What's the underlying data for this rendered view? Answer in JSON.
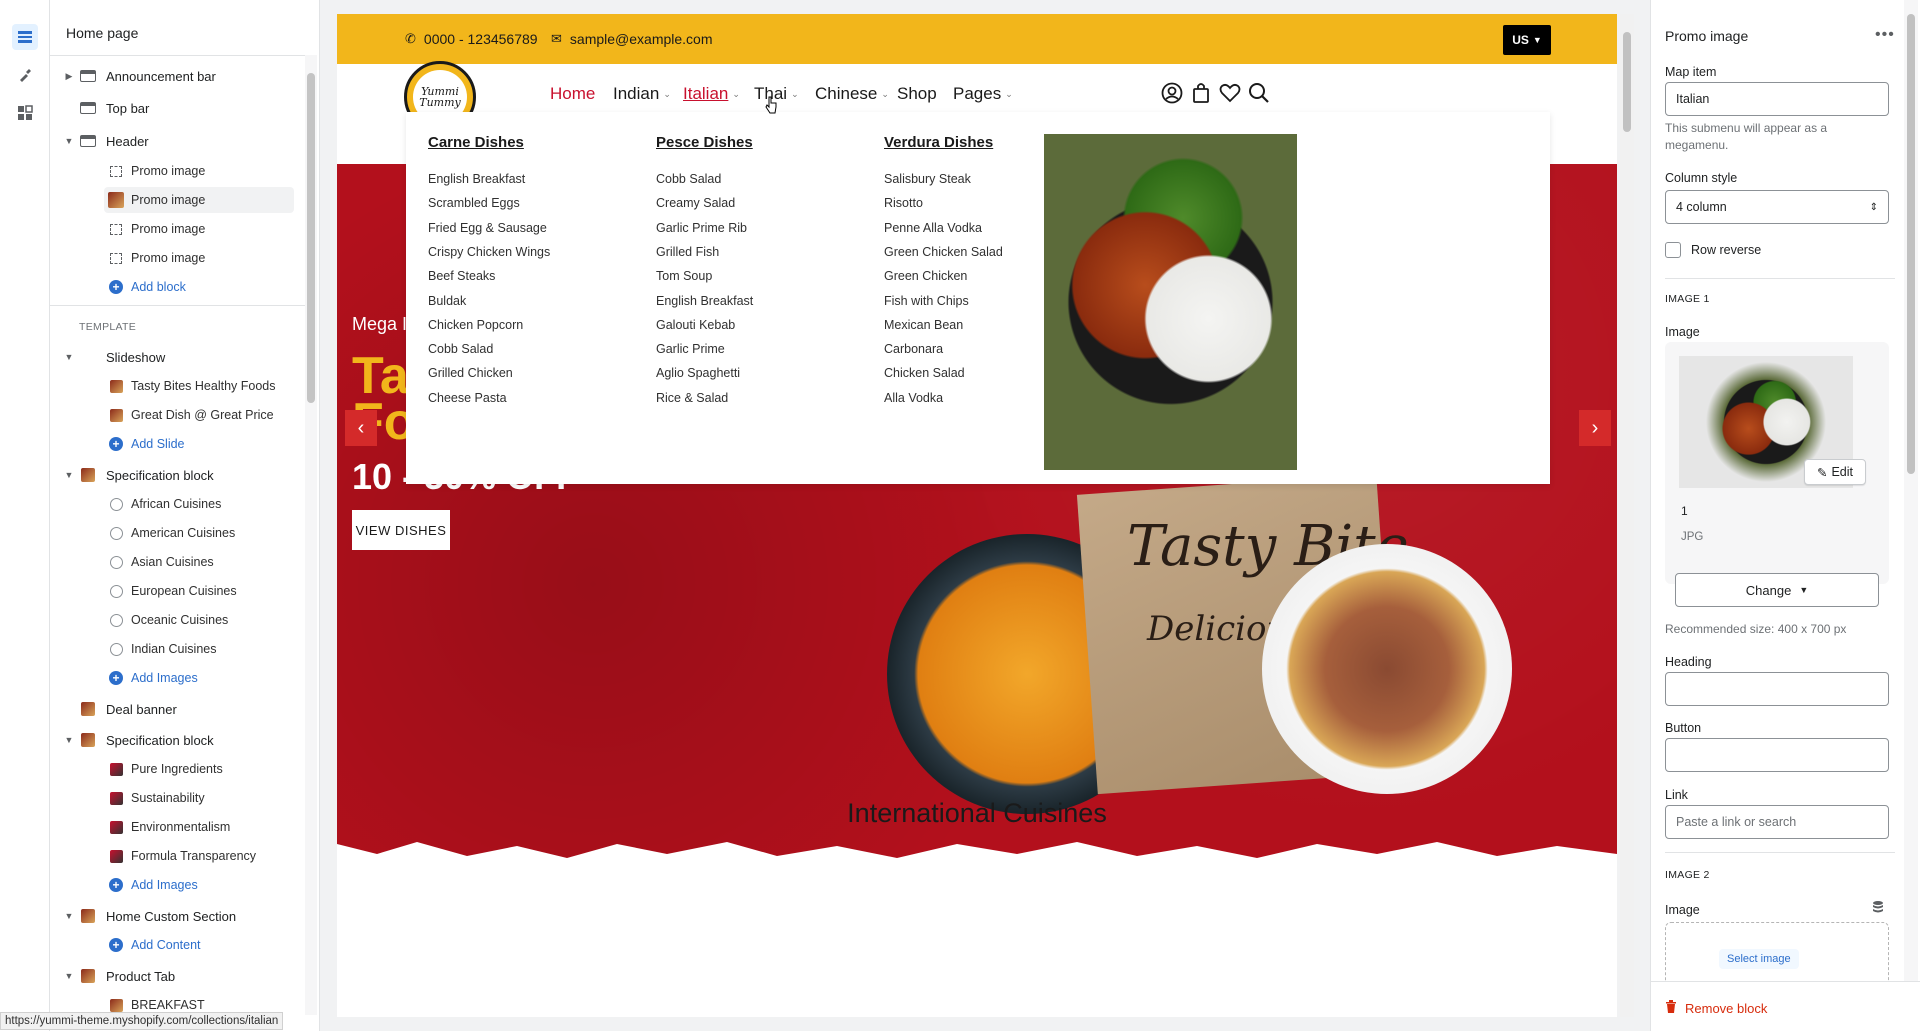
{
  "left_panel": {
    "title": "Home page",
    "tree": [
      {
        "label": "Announcement bar",
        "caret": "▶",
        "icon": "bar"
      },
      {
        "label": "Top bar",
        "caret": "",
        "icon": "bar"
      },
      {
        "label": "Header",
        "caret": "▼",
        "icon": "bar"
      },
      {
        "label": "Promo image",
        "icon": "dash"
      },
      {
        "label": "Promo image",
        "icon": "thumb"
      },
      {
        "label": "Promo image",
        "icon": "dash"
      },
      {
        "label": "Promo image",
        "icon": "dash"
      },
      {
        "label": "Add block",
        "icon": "plus"
      }
    ],
    "template_label": "TEMPLATE",
    "template_tree": [
      {
        "label": "Slideshow",
        "caret": "▼"
      },
      {
        "label": "Tasty Bites Healthy Foods"
      },
      {
        "label": "Great Dish @ Great Price"
      },
      {
        "label": "Add Slide"
      },
      {
        "label": "Specification block",
        "caret": "▼"
      },
      {
        "label": "African Cuisines"
      },
      {
        "label": "American Cuisines"
      },
      {
        "label": "Asian Cuisines"
      },
      {
        "label": "European Cuisines"
      },
      {
        "label": "Oceanic Cuisines"
      },
      {
        "label": "Indian Cuisines"
      },
      {
        "label": "Add Images"
      },
      {
        "label": "Deal banner"
      },
      {
        "label": "Specification block",
        "caret": "▼"
      },
      {
        "label": "Pure Ingredients"
      },
      {
        "label": "Sustainability"
      },
      {
        "label": "Environmentalism"
      },
      {
        "label": "Formula Transparency"
      },
      {
        "label": "Add Images"
      },
      {
        "label": "Home Custom Section",
        "caret": "▼"
      },
      {
        "label": "Add Content"
      },
      {
        "label": "Product Tab",
        "caret": "▼"
      },
      {
        "label": "BREAKFAST"
      }
    ]
  },
  "status_url": "https://yummi-theme.myshopify.com/collections/italian",
  "store": {
    "phone": "0000 - 123456789",
    "email": "sample@example.com",
    "currency": "US",
    "logo_line1": "Yummi",
    "logo_line2": "Tummy",
    "nav": [
      {
        "label": "Home",
        "active": true,
        "chevron": ""
      },
      {
        "label": "Indian",
        "chevron": "⌄"
      },
      {
        "label": "Italian",
        "hover": true,
        "chevron": "⌄"
      },
      {
        "label": "Thai",
        "chevron": "⌄"
      },
      {
        "label": "Chinese",
        "chevron": "⌄"
      },
      {
        "label": "Shop",
        "chevron": ""
      },
      {
        "label": "Pages",
        "chevron": "⌄"
      }
    ],
    "hero": {
      "subtitle": "Mega I",
      "heading_line1": "Ta",
      "heading_line2": "Foods",
      "offer": "10 - 50% OFF",
      "button": "VIEW DISHES",
      "bag_title": "Tasty Bite",
      "bag_subtitle": "Delicious Food",
      "prev": "‹",
      "next": "›"
    },
    "section_title": "International Cuisines"
  },
  "megamenu": {
    "columns": [
      {
        "heading": "Carne Dishes",
        "items": [
          "English Breakfast",
          "Scrambled Eggs",
          "Fried Egg & Sausage",
          "Crispy Chicken Wings",
          "Beef Steaks",
          "Buldak",
          "Chicken Popcorn",
          "Cobb Salad",
          "Grilled Chicken",
          "Cheese Pasta"
        ]
      },
      {
        "heading": "Pesce Dishes",
        "items": [
          "Cobb Salad",
          "Creamy Salad",
          "Garlic Prime Rib",
          "Grilled Fish",
          "Tom Soup",
          "English Breakfast",
          "Galouti Kebab",
          "Garlic Prime",
          "Aglio Spaghetti",
          "Rice & Salad"
        ]
      },
      {
        "heading": "Verdura Dishes",
        "items": [
          "Salisbury Steak",
          "Risotto",
          "Penne Alla Vodka",
          "Green Chicken Salad",
          "Green Chicken",
          "Fish with Chips",
          "Mexican Bean",
          "Carbonara",
          "Chicken Salad",
          "Alla Vodka"
        ]
      }
    ]
  },
  "right_panel": {
    "title": "Promo image",
    "more": "•••",
    "map_item_label": "Map item",
    "map_item_value": "Italian",
    "map_item_help": "This submenu will appear as a megamenu.",
    "column_style_label": "Column style",
    "column_style_value": "4 column",
    "row_reverse_label": "Row reverse",
    "image1_section": "IMAGE 1",
    "image_label": "Image",
    "edit_label": "Edit",
    "image_name": "1",
    "image_type": "JPG",
    "change_label": "Change",
    "recommended": "Recommended size: 400 x 700 px",
    "heading_label": "Heading",
    "button_label": "Button",
    "link_label": "Link",
    "link_placeholder": "Paste a link or search",
    "image2_section": "IMAGE 2",
    "image2_label": "Image",
    "select_image": "Select image",
    "remove_block": "Remove block"
  },
  "colors": {
    "accent_yellow": "#f2b61b",
    "hero_red": "#b3101c",
    "nav_active": "#c8102e",
    "admin_blue": "#2c6ecb",
    "danger": "#d72c0d"
  }
}
